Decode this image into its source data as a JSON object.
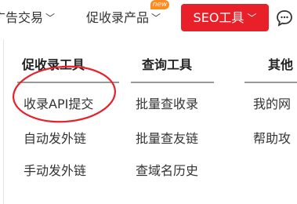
{
  "nav": {
    "item1": "广告交易",
    "item2": "促收录产品",
    "new_badge": "new",
    "seo_button": "SEO工具",
    "chat_icon": "chat-bubble-icon"
  },
  "dropdown": {
    "col1": {
      "title": "促收录工具",
      "links": [
        "收录API提交",
        "自动发外链",
        "手动发外链"
      ]
    },
    "col2": {
      "title": "查询工具",
      "links": [
        "批量查收录",
        "批量查友链",
        "查域名历史"
      ]
    },
    "col3": {
      "title": "其他",
      "links": [
        "我的网",
        "帮助攻"
      ]
    }
  },
  "colors": {
    "accent": "#e8202a",
    "badge": "#ff8a1e",
    "highlight": "#e8202a"
  }
}
